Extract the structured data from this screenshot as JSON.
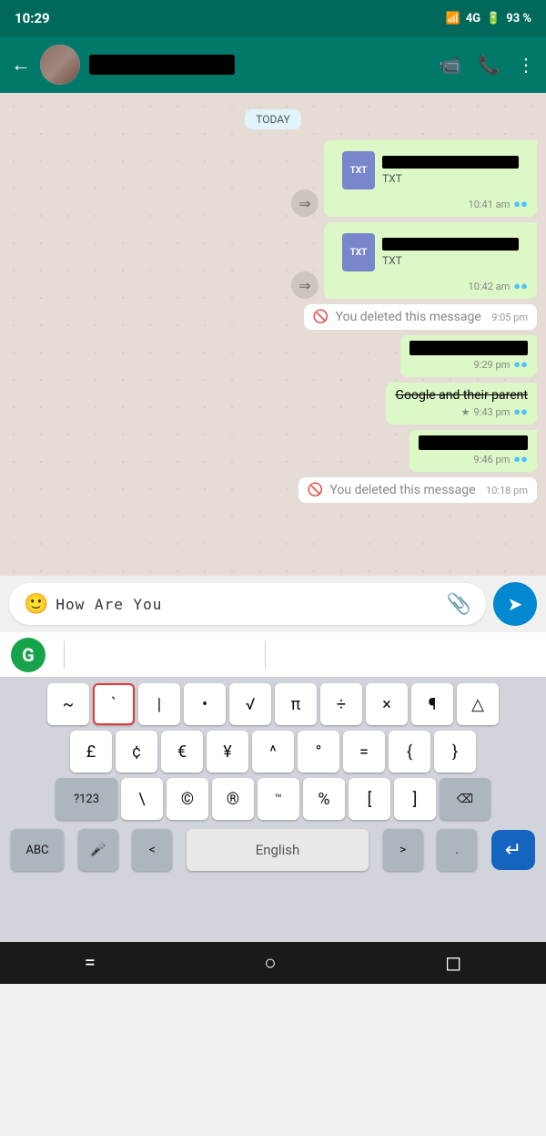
{
  "statusBar": {
    "time": "10:29",
    "signal": "4G",
    "battery": "93 %"
  },
  "topBar": {
    "contactName": "[redacted]",
    "videoCallLabel": "video-call",
    "voiceCallLabel": "voice-call",
    "menuLabel": "more-options"
  },
  "chat": {
    "dateBadge": "TODAY",
    "messages": [
      {
        "id": 1,
        "type": "file",
        "side": "sent",
        "fileType": "TXT",
        "timestamp": "10:41 am",
        "ticks": true
      },
      {
        "id": 2,
        "type": "file",
        "side": "sent",
        "fileType": "TXT",
        "timestamp": "10:42 am",
        "ticks": true
      },
      {
        "id": 3,
        "type": "deleted",
        "side": "sent",
        "text": "You deleted this message",
        "timestamp": "9:05 pm"
      },
      {
        "id": 4,
        "type": "redacted",
        "side": "sent",
        "timestamp": "9:29 pm",
        "ticks": true
      },
      {
        "id": 5,
        "type": "strikethrough",
        "side": "sent",
        "text": "Google and their parent",
        "timestamp": "9:43 pm",
        "ticks": true,
        "star": true
      },
      {
        "id": 6,
        "type": "redacted",
        "side": "sent",
        "timestamp": "9:46 pm",
        "ticks": true
      },
      {
        "id": 7,
        "type": "deleted",
        "side": "sent",
        "text": "You deleted this message",
        "timestamp": "10:18 pm"
      }
    ]
  },
  "inputBar": {
    "placeholder": "How Are You",
    "messageText": "How Are You"
  },
  "keyboard": {
    "grammarlyLabel": "G",
    "row1": [
      "~",
      "`",
      "|",
      "•",
      "√",
      "π",
      "÷",
      "×",
      "¶",
      "△"
    ],
    "row2": [
      "£",
      "¢",
      "€",
      "¥",
      "^",
      "°",
      "=",
      "{",
      "}"
    ],
    "row3Left": "?123",
    "row3": [
      "\\",
      "©",
      "®",
      "™",
      "%",
      "[",
      "]"
    ],
    "row3Right": "⌫",
    "bottomLeft": "ABC",
    "bottomMic": "🎤",
    "bottomLt": "<",
    "bottomSpace": "English",
    "bottomGt": ">",
    "bottomDot": ".",
    "bottomEnter": "↵"
  },
  "navBar": {
    "home": "=",
    "back": "○",
    "recents": "◻"
  }
}
